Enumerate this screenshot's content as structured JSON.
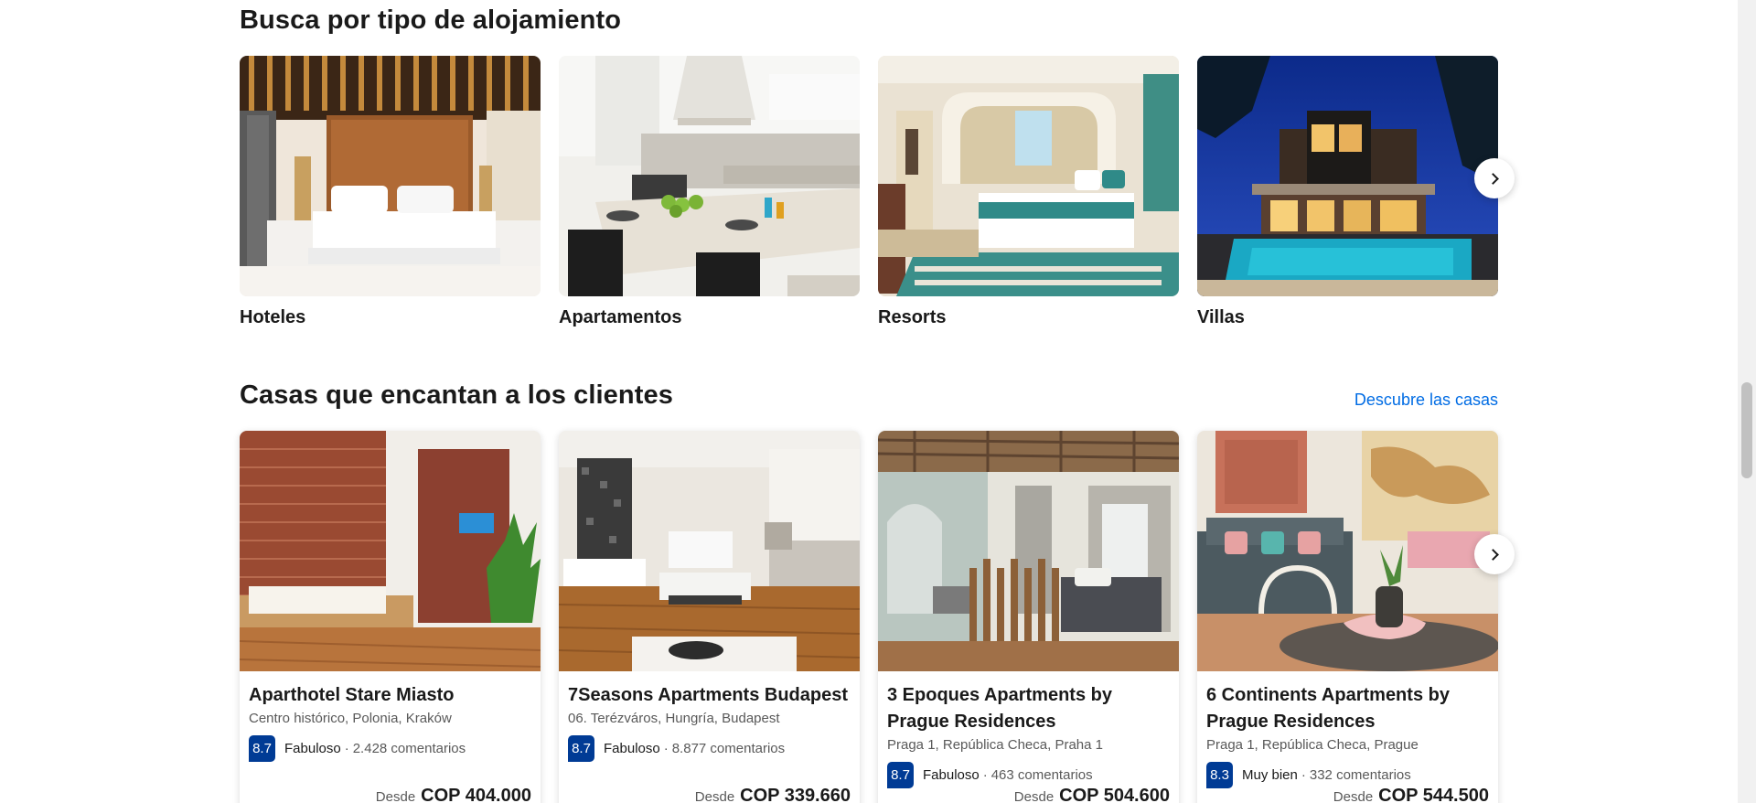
{
  "accommodation_types": {
    "title": "Busca por tipo de alojamiento",
    "items": [
      {
        "label": "Hoteles"
      },
      {
        "label": "Apartamentos"
      },
      {
        "label": "Resorts"
      },
      {
        "label": "Villas"
      }
    ]
  },
  "loved_homes": {
    "title": "Casas que encantan a los clientes",
    "link": "Descubre las casas",
    "items": [
      {
        "name": "Aparthotel Stare Miasto",
        "name2": "",
        "location": "Centro histórico, Polonia, Kraków",
        "score": "8.7",
        "rating_word": "Fabuloso",
        "separator": "·",
        "reviews": "2.428 comentarios",
        "price_prefix": "Desde",
        "price": "COP 404.000"
      },
      {
        "name": "7Seasons Apartments Budapest",
        "name2": "",
        "location": "06. Terézváros, Hungría, Budapest",
        "score": "8.7",
        "rating_word": "Fabuloso",
        "separator": "·",
        "reviews": "8.877 comentarios",
        "price_prefix": "Desde",
        "price": "COP 339.660"
      },
      {
        "name": "3 Epoques Apartments by",
        "name2": "Prague Residences",
        "location": "Praga 1, República Checa, Praha 1",
        "score": "8.7",
        "rating_word": "Fabuloso",
        "separator": "·",
        "reviews": "463 comentarios",
        "price_prefix": "Desde",
        "price": "COP 504.600"
      },
      {
        "name": "6 Continents Apartments by",
        "name2": "Prague Residences",
        "location": "Praga 1, República Checa, Prague",
        "score": "8.3",
        "rating_word": "Muy bien",
        "separator": "·",
        "reviews": "332 comentarios",
        "price_prefix": "Desde",
        "price": "COP 544.500"
      }
    ]
  },
  "icons": {
    "next_arrow": "chevron-right-icon"
  },
  "colors": {
    "link": "#006ce4",
    "score_badge": "#003b95"
  }
}
